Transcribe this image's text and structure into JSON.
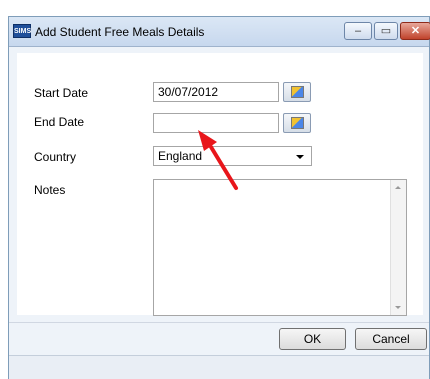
{
  "window": {
    "app_icon_text": "SIMS",
    "title": "Add Student Free Meals Details",
    "minimize_icon": "minimize-icon",
    "maximize_icon": "maximize-icon",
    "close_icon": "close-icon",
    "minimize_symbol": "–",
    "maximize_symbol": "▭",
    "close_symbol": "✕"
  },
  "form": {
    "start_date_label": "Start Date",
    "start_date_value": "30/07/2012",
    "end_date_label": "End Date",
    "end_date_value": "",
    "country_label": "Country",
    "country_value": "England",
    "notes_label": "Notes",
    "notes_value": ""
  },
  "buttons": {
    "ok": "OK",
    "cancel": "Cancel"
  },
  "annotation": {
    "arrow_color": "#e8161b"
  }
}
